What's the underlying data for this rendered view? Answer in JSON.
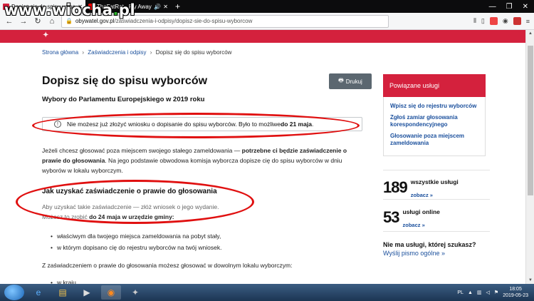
{
  "browser": {
    "tabs": [
      {
        "title": "Dopisz się do spisu wyborców",
        "active": true
      },
      {
        "title": "TheFatRat - Fly Away feat. A",
        "active": false
      }
    ],
    "new_tab": "+",
    "url_host": "obywatel.gov.pl",
    "url_path": "/zaswiadczenia-i-odpisy/dopisz-sie-do-spisu-wyborcow"
  },
  "watermark": {
    "pre": "www.wiocha",
    "dot": ".",
    "post": "pl"
  },
  "breadcrumb": {
    "home": "Strona główna",
    "section": "Zaświadczenia i odpisy",
    "current": "Dopisz się do spisu wyborców",
    "sep": "›"
  },
  "page": {
    "title": "Dopisz się do spisu wyborców",
    "subtitle": "Wybory do Parlamentu Europejskiego w 2019 roku",
    "print_label": "Drukuj",
    "alert_text": "Nie możesz już złożyć wniosku o dopisanie do spisu wyborców. Było to możliwe ",
    "alert_bold": "do 21 maja",
    "alert_end": ".",
    "p1_a": "Jeżeli chcesz głosować poza miejscem swojego stałego zameldowania — ",
    "p1_b": "potrzebne ci będzie zaświadczenie o prawie do głosowania",
    "p1_c": ". Na jego podstawie obwodowa komisja wyborcza dopisze cię do spisu wyborców w dniu wyborów w lokalu wyborczym.",
    "section_title": "Jak uzyskać zaświadczenie o prawie do głosowania",
    "p2_a": "Aby uzyskać takie zaświadczenie —  złóż wniosek o jego wydanie.",
    "p2_b": "Możesz to zrobić ",
    "p2_c": "do 24 maja w urzędzie gminy:",
    "list": [
      "właściwym dla twojego miejsca zameldowania na pobyt stały,",
      "w którym dopisano cię do rejestru wyborców na twój wniosek."
    ],
    "p3": "Z zaświadczeniem o prawie do głosowania możesz głosować w dowolnym lokalu wyborczym:",
    "list2": [
      "w kraju,"
    ]
  },
  "sidebar": {
    "heading": "Powiązane usługi",
    "links": [
      "Wpisz się do rejestru wyborców",
      "Zgłoś zamiar głosowania korespondencyjnego",
      "Głosowanie poza miejscem zameldowania"
    ],
    "stat1": {
      "num": "189",
      "label": "wszystkie usługi",
      "link": "zobacz »"
    },
    "stat2": {
      "num": "53",
      "label": "usługi online",
      "link": "zobacz »"
    },
    "question": "Nie ma usługi, której szukasz?",
    "question_link": "Wyślij pismo ogólne »"
  },
  "taskbar": {
    "lang": "PL",
    "time": "18:05",
    "date": "2019-05-23"
  },
  "colors": {
    "brand_red": "#d4213d",
    "link_blue": "#1a4f9c",
    "annotation_red": "#e01010"
  }
}
